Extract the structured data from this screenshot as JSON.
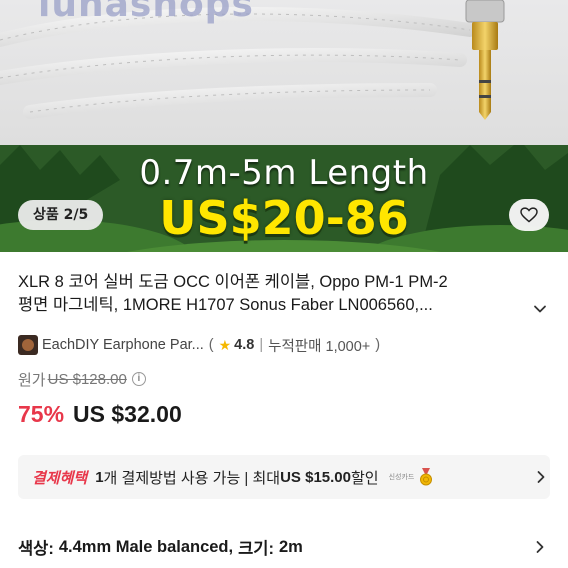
{
  "hero": {
    "watermark": "lunashops",
    "banner_length": "0.7m-5m Length",
    "banner_price": "US$20-86",
    "image_counter": "상품 2/5",
    "wishlist_icon": "heart-outline-icon"
  },
  "product": {
    "title_line1": "XLR 8 코어 실버 도금 OCC 이어폰 케이블, Oppo PM-1 PM-2",
    "title_line2": "평면 마그네틱, 1MORE H1707 Sonus Faber LN006560,...",
    "store_name": "EachDIY Earphone Par...",
    "rating": "4.8",
    "sales": "누적판매 1,000+",
    "original_label": "원가",
    "original_price": "US $128.00",
    "discount": "75%",
    "sale_price": "US $32.00"
  },
  "benefit": {
    "label": "결제혜택",
    "count": "1",
    "text_a": "개 결제방법 사용 가능 | 최대 ",
    "amount": "US $15.00",
    "text_b": " 할인",
    "badge_text": "신성카드"
  },
  "option": {
    "color_label": "색상:",
    "color_value": "4.4mm Male balanced,",
    "size_label": "크기:",
    "size_value": "2m"
  },
  "colors": {
    "accent_red": "#e8374a",
    "banner_green": "#274f24",
    "banner_yellow": "#ffe600",
    "star": "#f5b800"
  }
}
